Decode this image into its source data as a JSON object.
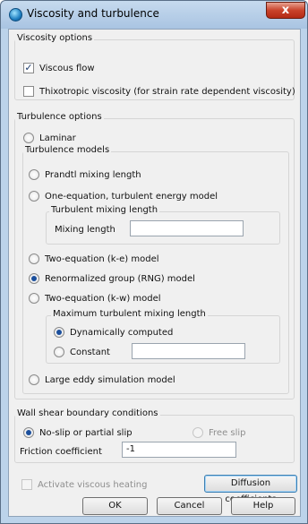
{
  "window": {
    "title": "Viscosity and turbulence",
    "close_glyph": "x"
  },
  "viscosity": {
    "label": "Viscosity options",
    "viscous_flow": {
      "label": "Viscous flow",
      "checked": true
    },
    "thixotropic": {
      "label": "Thixotropic viscosity (for strain rate dependent viscosity)",
      "checked": false
    }
  },
  "turbulence": {
    "label": "Turbulence options",
    "laminar": "Laminar",
    "models_label": "Turbulence models",
    "prandtl": "Prandtl mixing length",
    "one_equation": "One-equation, turbulent energy model",
    "tml_group_label": "Turbulent mixing length",
    "mixing_length_label": "Mixing length",
    "mixing_length_value": "",
    "two_eq_ke": "Two-equation (k-e) model",
    "rng": "Renormalized group (RNG) model",
    "two_eq_kw": "Two-equation (k-w) model",
    "max_tml_label": "Maximum turbulent mixing length",
    "dynamically_computed": "Dynamically computed",
    "constant": "Constant",
    "constant_value": "",
    "les": "Large eddy simulation model",
    "selected_model": "rng",
    "selected_max_length": "dynamically_computed"
  },
  "wall_shear": {
    "label": "Wall shear boundary conditions",
    "no_slip": "No-slip or partial slip",
    "free_slip": "Free slip",
    "friction_label": "Friction coefficient",
    "friction_value": "-1",
    "selected": "no_slip"
  },
  "footer": {
    "viscous_heating": {
      "label": "Activate viscous heating",
      "checked": false,
      "enabled": false
    },
    "diffusion_button": "Diffusion coefficients",
    "ok": "OK",
    "cancel": "Cancel",
    "help": "Help"
  }
}
